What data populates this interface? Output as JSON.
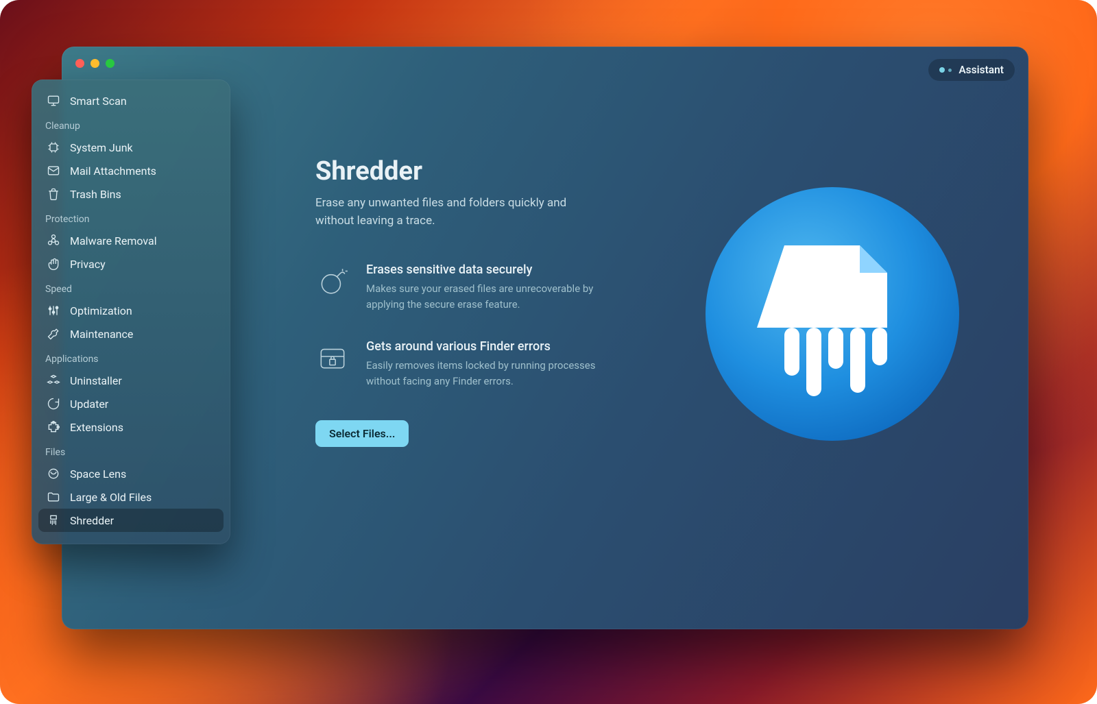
{
  "assistant_label": "Assistant",
  "sidebar": {
    "top_item": {
      "label": "Smart Scan"
    },
    "sections": [
      {
        "label": "Cleanup",
        "items": [
          {
            "id": "system-junk",
            "label": "System Junk"
          },
          {
            "id": "mail-attachments",
            "label": "Mail Attachments"
          },
          {
            "id": "trash-bins",
            "label": "Trash Bins"
          }
        ]
      },
      {
        "label": "Protection",
        "items": [
          {
            "id": "malware",
            "label": "Malware Removal"
          },
          {
            "id": "privacy",
            "label": "Privacy"
          }
        ]
      },
      {
        "label": "Speed",
        "items": [
          {
            "id": "optimization",
            "label": "Optimization"
          },
          {
            "id": "maintenance",
            "label": "Maintenance"
          }
        ]
      },
      {
        "label": "Applications",
        "items": [
          {
            "id": "uninstaller",
            "label": "Uninstaller"
          },
          {
            "id": "updater",
            "label": "Updater"
          },
          {
            "id": "extensions",
            "label": "Extensions"
          }
        ]
      },
      {
        "label": "Files",
        "items": [
          {
            "id": "space-lens",
            "label": "Space Lens"
          },
          {
            "id": "large-old",
            "label": "Large & Old Files"
          },
          {
            "id": "shredder",
            "label": "Shredder",
            "active": true
          }
        ]
      }
    ]
  },
  "main": {
    "title": "Shredder",
    "subtitle": "Erase any unwanted files and folders quickly and without leaving a trace.",
    "features": [
      {
        "title": "Erases sensitive data securely",
        "desc": "Makes sure your erased files are unrecoverable by applying the secure erase feature."
      },
      {
        "title": "Gets around various Finder errors",
        "desc": "Easily removes items locked by running processes without facing any Finder errors."
      }
    ],
    "cta_label": "Select Files..."
  }
}
